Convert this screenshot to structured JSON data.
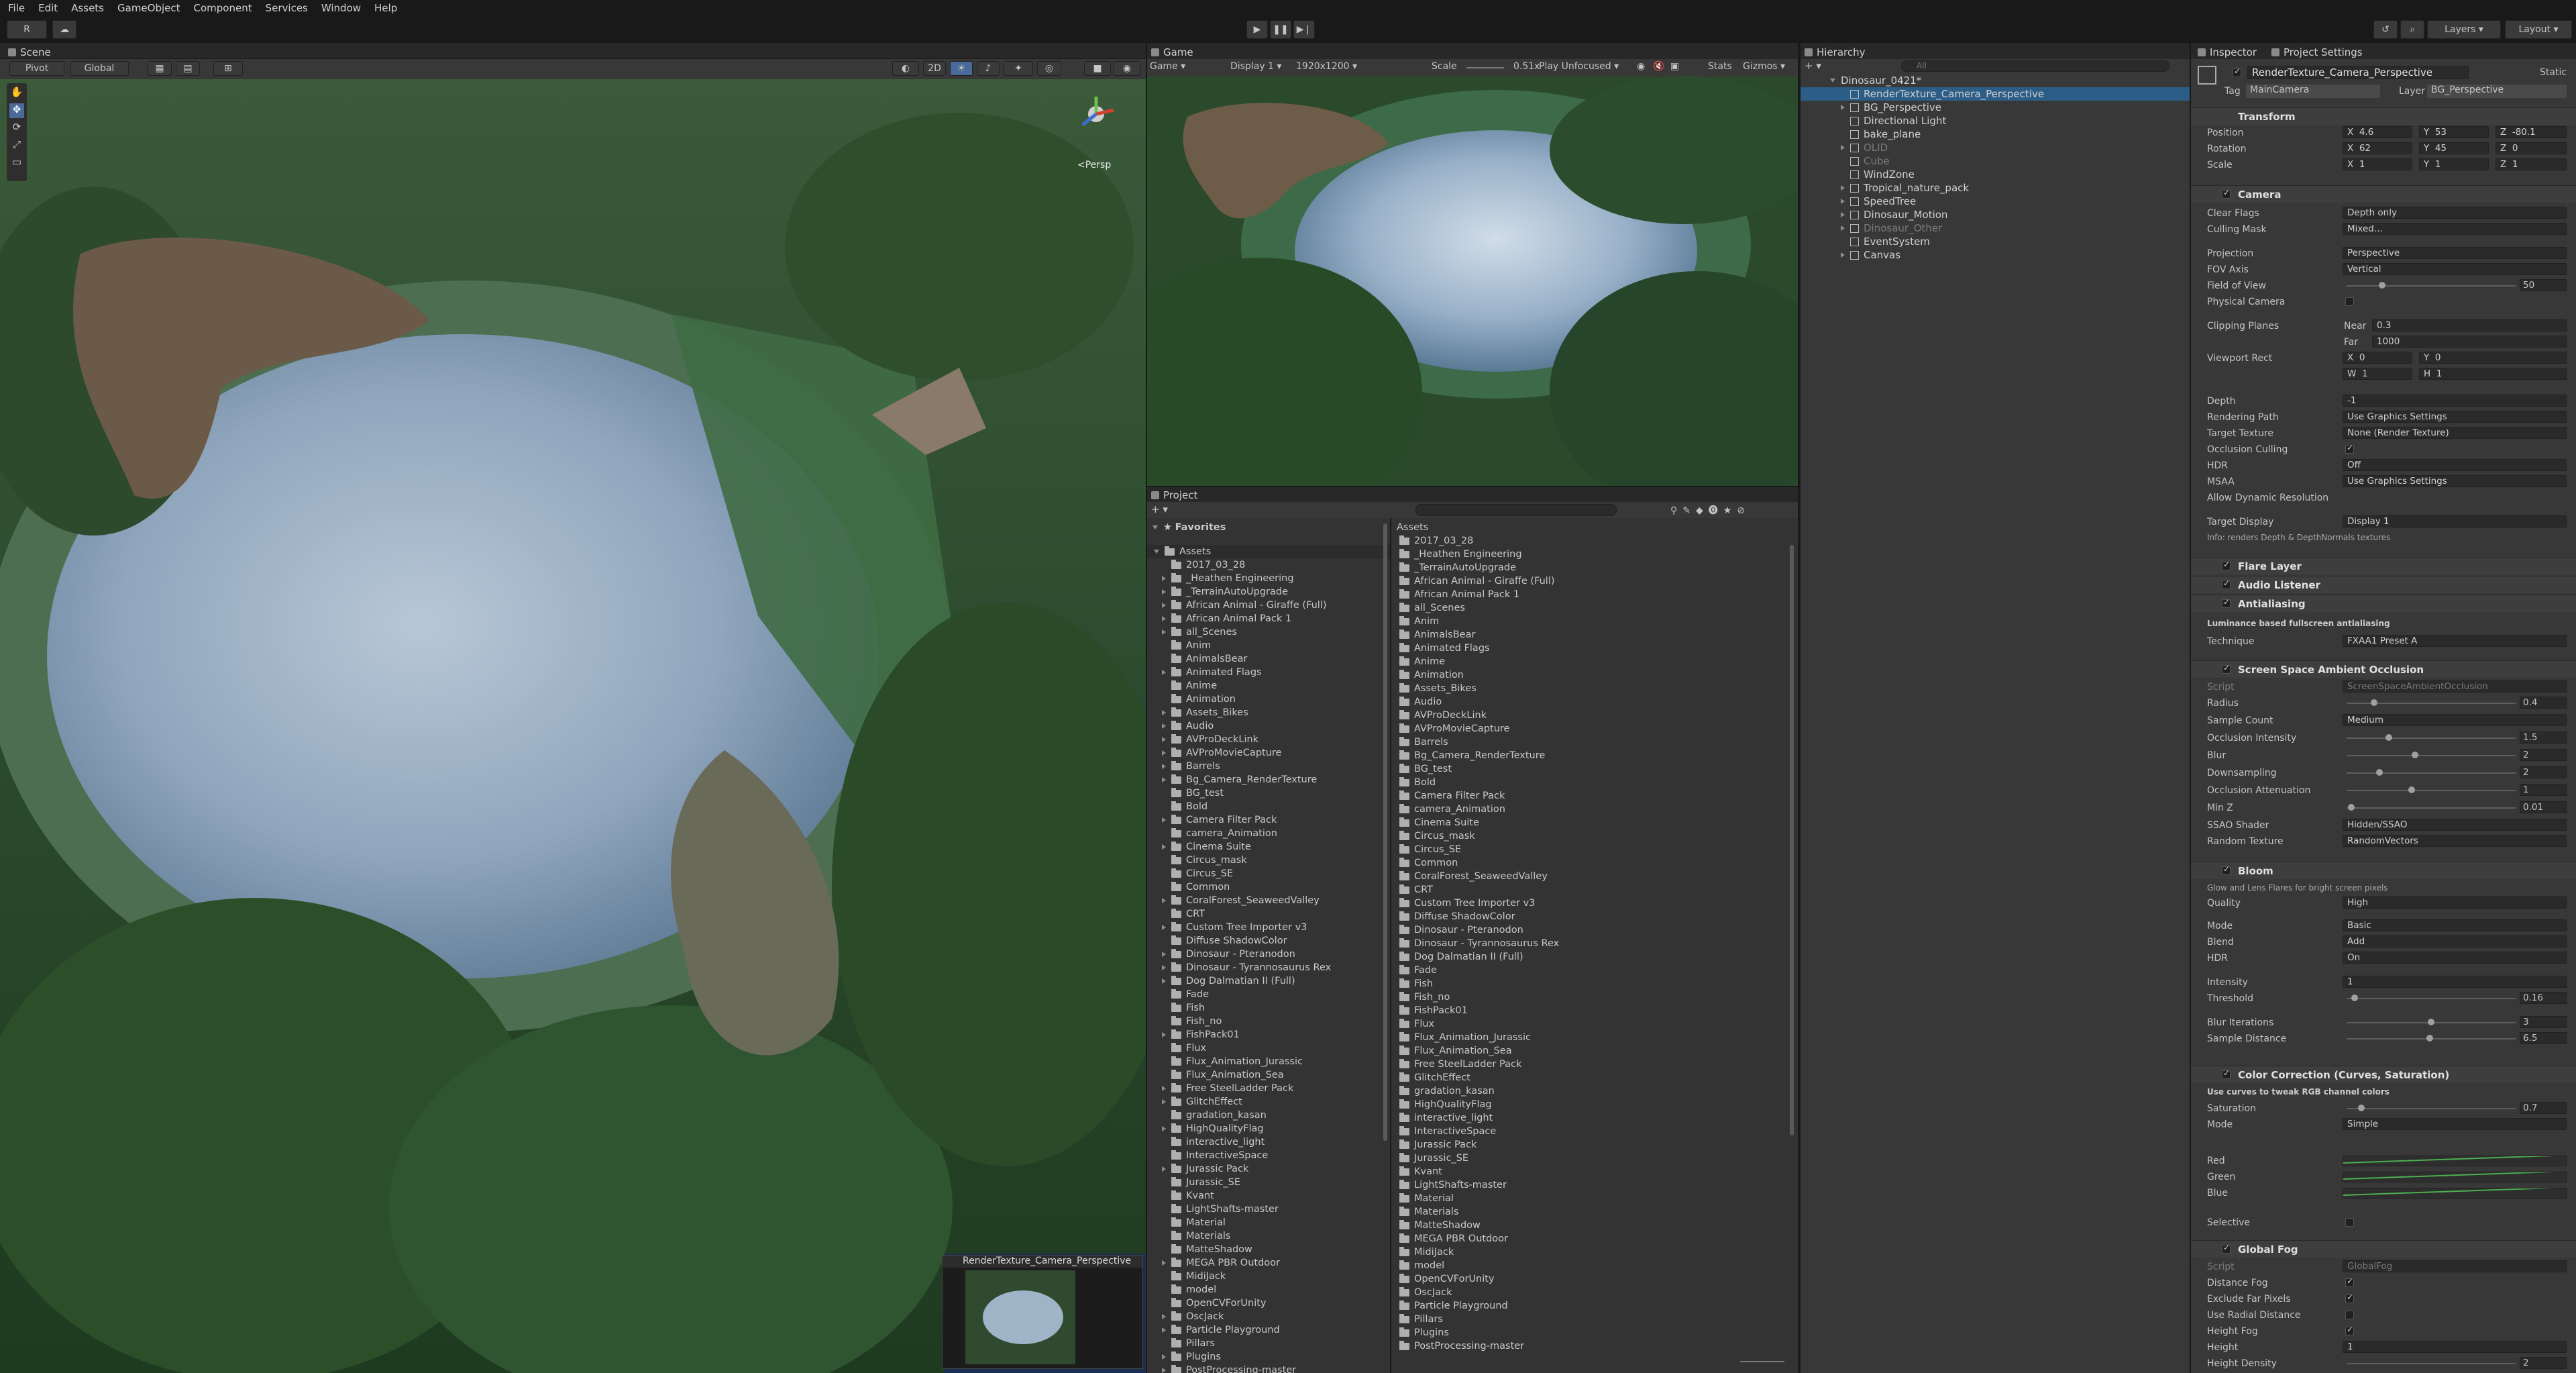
{
  "menu": [
    "File",
    "Edit",
    "Assets",
    "GameObject",
    "Component",
    "Services",
    "Window",
    "Help"
  ],
  "toolbar": {
    "account": "R",
    "layers": "Layers",
    "layout": "Layout"
  },
  "scene": {
    "tab": "Scene",
    "pivot": "Pivot",
    "global": "Global",
    "mode2d": "2D",
    "gizmo_label": "<Persp",
    "camera_preview_title": "RenderTexture_Camera_Perspective"
  },
  "game": {
    "tab": "Game",
    "type": "Game",
    "display": "Display 1",
    "resolution": "1920x1200",
    "scale_label": "Scale",
    "scale_value": "0.51x",
    "play_mode": "Play Unfocused",
    "stats": "Stats",
    "gizmos": "Gizmos"
  },
  "project": {
    "tab": "Project",
    "favorites": "Favorites",
    "assets_root": "Assets",
    "breadcrumb": "Assets",
    "folders": [
      "2017_03_28",
      "_Heathen Engineering",
      "_TerrainAutoUpgrade",
      "African Animal - Giraffe (Full)",
      "African Animal Pack 1",
      "all_Scenes",
      "Anim",
      "AnimalsBear",
      "Animated Flags",
      "Anime",
      "Animation",
      "Assets_Bikes",
      "Audio",
      "AVProDeckLink",
      "AVProMovieCapture",
      "Barrels",
      "Bg_Camera_RenderTexture",
      "BG_test",
      "Bold",
      "Camera Filter Pack",
      "camera_Animation",
      "Cinema Suite",
      "Circus_mask",
      "Circus_SE",
      "Common",
      "CoralForest_SeaweedValley",
      "CRT",
      "Custom Tree Importer v3",
      "Diffuse ShadowColor",
      "Dinosaur - Pteranodon",
      "Dinosaur - Tyrannosaurus Rex",
      "Dog Dalmatian II (Full)",
      "Fade",
      "Fish",
      "Fish_no",
      "FishPack01",
      "Flux",
      "Flux_Animation_Jurassic",
      "Flux_Animation_Sea",
      "Free SteelLadder Pack",
      "GlitchEffect",
      "gradation_kasan",
      "HighQualityFlag",
      "interactive_light",
      "InteractiveSpace",
      "Jurassic Pack",
      "Jurassic_SE",
      "Kvant",
      "LightShafts-master",
      "Material",
      "Materials",
      "MatteShadow",
      "MEGA PBR Outdoor",
      "MidiJack",
      "model",
      "OpenCVForUnity",
      "OscJack",
      "Particle Playground",
      "Pillars",
      "Plugins",
      "PostProcessing-master"
    ]
  },
  "hierarchy": {
    "tab": "Hierarchy",
    "search_placeholder": "All",
    "scene_name": "Dinosaur_0421*",
    "items": [
      {
        "name": "RenderTexture_Camera_Perspective",
        "selected": true,
        "dim": false,
        "expandable": false
      },
      {
        "name": "BG_Perspective",
        "selected": false,
        "dim": false,
        "expandable": true
      },
      {
        "name": "Directional Light",
        "selected": false,
        "dim": false,
        "expandable": false
      },
      {
        "name": "bake_plane",
        "selected": false,
        "dim": false,
        "expandable": false
      },
      {
        "name": "OLID",
        "selected": false,
        "dim": true,
        "expandable": true
      },
      {
        "name": "Cube",
        "selected": false,
        "dim": true,
        "expandable": false
      },
      {
        "name": "WindZone",
        "selected": false,
        "dim": false,
        "expandable": false
      },
      {
        "name": "Tropical_nature_pack",
        "selected": false,
        "dim": false,
        "expandable": true
      },
      {
        "name": "SpeedTree",
        "selected": false,
        "dim": false,
        "expandable": true
      },
      {
        "name": "Dinosaur_Motion",
        "selected": false,
        "dim": false,
        "expandable": true
      },
      {
        "name": "Dinosaur_Other",
        "selected": false,
        "dim": true,
        "expandable": true
      },
      {
        "name": "EventSystem",
        "selected": false,
        "dim": false,
        "expandable": false
      },
      {
        "name": "Canvas",
        "selected": false,
        "dim": false,
        "expandable": true
      }
    ]
  },
  "inspector": {
    "tab": "Inspector",
    "tab2": "Project Settings",
    "object_name": "RenderTexture_Camera_Perspective",
    "static": "Static",
    "tag_label": "Tag",
    "tag": "MainCamera",
    "layer_label": "Layer",
    "layer": "BG_Perspective",
    "transform": {
      "title": "Transform",
      "position_label": "Position",
      "px": "4.6",
      "py": "53",
      "pz": "-80.1",
      "rotation_label": "Rotation",
      "rx": "62",
      "ry": "45",
      "rz": "0",
      "scale_label": "Scale",
      "sx": "1",
      "sy": "1",
      "sz": "1"
    },
    "camera": {
      "title": "Camera",
      "clear_flags_label": "Clear Flags",
      "clear_flags": "Depth only",
      "culling_label": "Culling Mask",
      "culling": "Mixed...",
      "projection_label": "Projection",
      "projection": "Perspective",
      "fov_axis_label": "FOV Axis",
      "fov_axis": "Vertical",
      "fov_label": "Field of View",
      "fov": "50",
      "fov_fraction": 0.2,
      "physical_label": "Physical Camera",
      "clipping_label": "Clipping Planes",
      "near_label": "Near",
      "near": "0.3",
      "far_label": "Far",
      "far": "1000",
      "viewport_label": "Viewport Rect",
      "vx": "0",
      "vy": "0",
      "vw": "1",
      "vh": "1",
      "depth_label": "Depth",
      "depth": "-1",
      "rendering_label": "Rendering Path",
      "rendering": "Use Graphics Settings",
      "target_label": "Target Texture",
      "target": "None (Render Texture)",
      "occlusion_label": "Occlusion Culling",
      "hdr_label": "HDR",
      "hdr": "Off",
      "msaa_label": "MSAA",
      "msaa": "Use Graphics Settings",
      "dynres_label": "Allow Dynamic Resolution",
      "display_label": "Target Display",
      "display": "Display 1",
      "info": "Info: renders Depth & DepthNormals textures"
    },
    "flare": "Flare Layer",
    "audio": "Audio Listener",
    "aa": {
      "title": "Antialiasing",
      "desc": "Luminance based fullscreen antialiasing",
      "tech_label": "Technique",
      "tech": "FXAA1 Preset A"
    },
    "ssao": {
      "title": "Screen Space Ambient Occlusion",
      "script_label": "Script",
      "script": "ScreenSpaceAmbientOcclusion",
      "radius_label": "Radius",
      "radius": "0.4",
      "radius_f": 0.15,
      "sample_label": "Sample Count",
      "sample": "Medium",
      "intensity_label": "Occlusion Intensity",
      "intensity": "1.5",
      "intensity_f": 0.24,
      "blur_label": "Blur",
      "blur": "2",
      "blur_f": 0.4,
      "down_label": "Downsampling",
      "down": "2",
      "down_f": 0.18,
      "atten_label": "Occlusion Attenuation",
      "atten": "1",
      "atten_f": 0.38,
      "minz_label": "Min Z",
      "minz": "0.01",
      "minz_f": 0.01,
      "shader_label": "SSAO Shader",
      "shader": "Hidden/SSAO",
      "random_label": "Random Texture",
      "random": "RandomVectors"
    },
    "bloom": {
      "title": "Bloom",
      "desc": "Glow and Lens Flares for bright screen pixels",
      "quality_label": "Quality",
      "quality": "High",
      "mode_label": "Mode",
      "mode": "Basic",
      "blend_label": "Blend",
      "blend": "Add",
      "hdr_label": "HDR",
      "hdr": "On",
      "intensity_label": "Intensity",
      "intensity": "1",
      "threshold_label": "Threshold",
      "threshold": "0.16",
      "threshold_f": 0.03,
      "iter_label": "Blur Iterations",
      "iter": "3",
      "iter_f": 0.5,
      "dist_label": "Sample Distance",
      "dist": "6.5",
      "dist_f": 0.49
    },
    "cc": {
      "title": "Color Correction (Curves, Saturation)",
      "desc": "Use curves to tweak RGB channel colors",
      "sat_label": "Saturation",
      "sat": "0.7",
      "sat_f": 0.07,
      "mode_label": "Mode",
      "mode": "Simple",
      "red": "Red",
      "green": "Green",
      "blue": "Blue",
      "selective": "Selective"
    },
    "fog": {
      "title": "Global Fog",
      "script_label": "Script",
      "script": "GlobalFog",
      "dist_label": "Distance Fog",
      "exclude_label": "Exclude Far Pixels",
      "radial_label": "Use Radial Distance",
      "height_fog_label": "Height Fog",
      "height_label": "Height",
      "height": "1",
      "density_label": "Height Density",
      "density": "2"
    }
  }
}
